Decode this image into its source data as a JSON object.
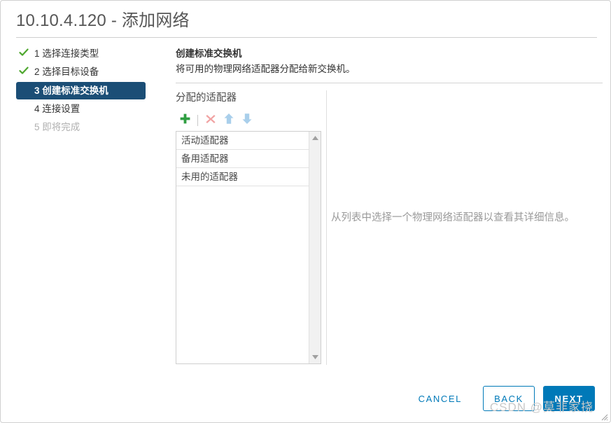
{
  "dialog": {
    "title": "10.10.4.120 - 添加网络"
  },
  "steps": [
    {
      "num": "1",
      "label": "1 选择连接类型",
      "state": "done"
    },
    {
      "num": "2",
      "label": "2 选择目标设备",
      "state": "done"
    },
    {
      "num": "3",
      "label": "3 创建标准交换机",
      "state": "current"
    },
    {
      "num": "4",
      "label": "4 连接设置",
      "state": "upcoming"
    },
    {
      "num": "5",
      "label": "5 即将完成",
      "state": "disabled"
    }
  ],
  "content": {
    "title": "创建标准交换机",
    "subtitle": "将可用的物理网络适配器分配给新交换机。"
  },
  "adapters": {
    "heading": "分配的适配器",
    "toolbar": [
      {
        "name": "add-adapter-button",
        "icon": "plus-icon",
        "enabled": true
      },
      {
        "name": "remove-adapter-button",
        "icon": "close-x-icon",
        "enabled": false
      },
      {
        "name": "move-up-button",
        "icon": "arrow-up-icon",
        "enabled": false
      },
      {
        "name": "move-down-button",
        "icon": "arrow-down-icon",
        "enabled": false
      }
    ],
    "rows": [
      {
        "label": "活动适配器"
      },
      {
        "label": "备用适配器"
      },
      {
        "label": "未用的适配器"
      }
    ]
  },
  "detail": {
    "empty_message": "从列表中选择一个物理网络适配器以查看其详细信息。"
  },
  "footer": {
    "cancel_label": "CANCEL",
    "back_label": "BACK",
    "next_label": "NEXT"
  },
  "watermark": {
    "text": "CSDN @莫非家挠"
  },
  "colors": {
    "accent_blue": "#0079b8",
    "step_active_bg": "#1b4e76",
    "check_green": "#4ea72e",
    "disabled_text": "#b0b0b0",
    "muted_text": "#9a9a9a"
  }
}
